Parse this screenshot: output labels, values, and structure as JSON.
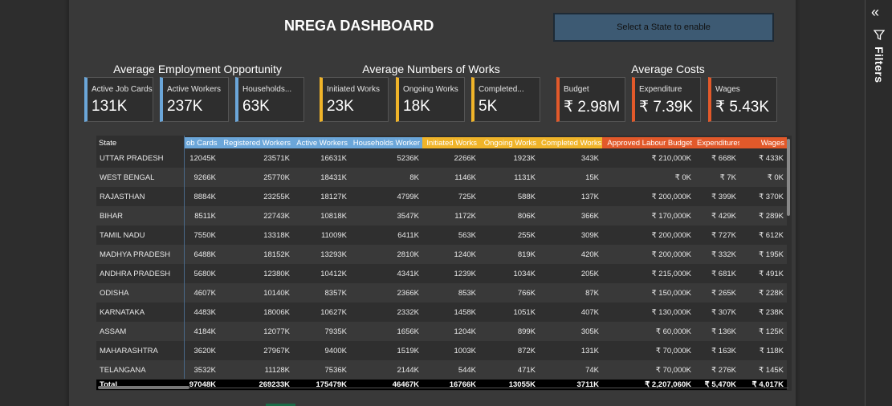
{
  "header": {
    "title": "NREGA DASHBOARD",
    "state_button": "Select a State to enable"
  },
  "filters_pane": {
    "label": "Filters",
    "collapse_icon": "double-chevron-left-icon",
    "filter_icon": "funnel-icon"
  },
  "sections": [
    {
      "title": "Average Employment Opportunity",
      "color": "#6ba6d9",
      "cards": [
        {
          "label": "Active Job Cards",
          "value": "131K"
        },
        {
          "label": "Active Workers",
          "value": "237K"
        },
        {
          "label": "Households...",
          "value": "63K"
        }
      ]
    },
    {
      "title": "Average Numbers of Works",
      "color": "#f0b429",
      "cards": [
        {
          "label": "Initiated Works",
          "value": "23K"
        },
        {
          "label": "Ongoing Works",
          "value": "18K"
        },
        {
          "label": "Completed...",
          "value": "5K"
        }
      ]
    },
    {
      "title": "Average Costs",
      "color": "#e2592a",
      "cards": [
        {
          "label": "Budget",
          "value": "₹ 2.98M"
        },
        {
          "label": "Expenditure",
          "value": "₹ 7.39K"
        },
        {
          "label": "Wages",
          "value": "₹ 5.43K"
        }
      ]
    }
  ],
  "table": {
    "columns": [
      "State",
      "ob Cards",
      "Registered Workers",
      "Active Workers",
      "Households Worker",
      "Initiated Works",
      "Ongoing Works",
      "Completed Works",
      "Approved Labour Budget",
      "Expenditures",
      "Wages"
    ],
    "rows": [
      [
        "UTTAR PRADESH",
        "12045K",
        "23571K",
        "16631K",
        "5236K",
        "2266K",
        "1923K",
        "343K",
        "₹ 210,000K",
        "₹ 668K",
        "₹ 433K"
      ],
      [
        "WEST BENGAL",
        "9266K",
        "25770K",
        "18431K",
        "8K",
        "1146K",
        "1131K",
        "15K",
        "₹ 0K",
        "₹ 7K",
        "₹ 0K"
      ],
      [
        "RAJASTHAN",
        "8884K",
        "23255K",
        "18127K",
        "4799K",
        "725K",
        "588K",
        "137K",
        "₹ 200,000K",
        "₹ 399K",
        "₹ 370K"
      ],
      [
        "BIHAR",
        "8511K",
        "22743K",
        "10818K",
        "3547K",
        "1172K",
        "806K",
        "366K",
        "₹ 170,000K",
        "₹ 429K",
        "₹ 289K"
      ],
      [
        "TAMIL NADU",
        "7550K",
        "13318K",
        "11009K",
        "6411K",
        "563K",
        "255K",
        "309K",
        "₹ 200,000K",
        "₹ 727K",
        "₹ 612K"
      ],
      [
        "MADHYA PRADESH",
        "6488K",
        "18152K",
        "13293K",
        "2810K",
        "1240K",
        "819K",
        "420K",
        "₹ 200,000K",
        "₹ 332K",
        "₹ 195K"
      ],
      [
        "ANDHRA PRADESH",
        "5680K",
        "12380K",
        "10412K",
        "4341K",
        "1239K",
        "1034K",
        "205K",
        "₹ 215,000K",
        "₹ 681K",
        "₹ 491K"
      ],
      [
        "ODISHA",
        "4607K",
        "10140K",
        "8357K",
        "2366K",
        "853K",
        "766K",
        "87K",
        "₹ 150,000K",
        "₹ 265K",
        "₹ 228K"
      ],
      [
        "KARNATAKA",
        "4483K",
        "18006K",
        "10627K",
        "2332K",
        "1458K",
        "1051K",
        "407K",
        "₹ 130,000K",
        "₹ 307K",
        "₹ 238K"
      ],
      [
        "ASSAM",
        "4184K",
        "12077K",
        "7935K",
        "1656K",
        "1204K",
        "899K",
        "305K",
        "₹ 60,000K",
        "₹ 136K",
        "₹ 125K"
      ],
      [
        "MAHARASHTRA",
        "3620K",
        "27967K",
        "9400K",
        "1519K",
        "1003K",
        "872K",
        "131K",
        "₹ 70,000K",
        "₹ 163K",
        "₹ 118K"
      ],
      [
        "TELANGANA",
        "3532K",
        "11128K",
        "7536K",
        "2144K",
        "544K",
        "471K",
        "74K",
        "₹ 70,000K",
        "₹ 276K",
        "₹ 145K"
      ]
    ],
    "total": [
      "Total",
      "97048K",
      "269233K",
      "175479K",
      "46467K",
      "16766K",
      "13055K",
      "3711K",
      "₹ 2,207,060K",
      "₹ 5,470K",
      "₹ 4,017K"
    ]
  }
}
